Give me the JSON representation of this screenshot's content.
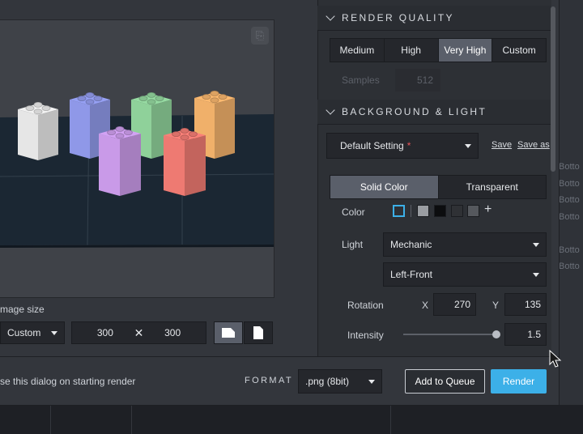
{
  "viewport": {
    "bricks": [
      {
        "name": "white",
        "color": "#e6e6e6"
      },
      {
        "name": "blue",
        "color": "#8f98e8"
      },
      {
        "name": "green",
        "color": "#8fd19a"
      },
      {
        "name": "orange",
        "color": "#f0b06a"
      },
      {
        "name": "purple",
        "color": "#c99ae8"
      },
      {
        "name": "red",
        "color": "#ee7a72"
      }
    ]
  },
  "image_size": {
    "label": "mage size",
    "preset": "Custom",
    "width": "300",
    "times": "✕",
    "height": "300"
  },
  "footer": {
    "close_text": "se this dialog on starting render",
    "format_label": "FORMAT",
    "format_value": ".png (8bit)",
    "add_to_queue": "Add to Queue",
    "render": "Render"
  },
  "render_quality": {
    "title": "RENDER QUALITY",
    "options": [
      "Medium",
      "High",
      "Very High",
      "Custom"
    ],
    "selected": "Very High",
    "samples_label": "Samples",
    "samples_value": "512"
  },
  "background_light": {
    "title": "BACKGROUND & LIGHT",
    "preset": "Default Setting",
    "preset_marker": "*",
    "save": "Save",
    "save_as": "Save as",
    "modes": [
      "Solid Color",
      "Transparent"
    ],
    "mode_selected": "Solid Color",
    "color_label": "Color",
    "swatches": [
      "#2d3035",
      "#9a9da2",
      "#0c0d0f",
      "#2f3135",
      "#55585d"
    ],
    "add_swatch": "+",
    "light_label": "Light",
    "light_value": "Mechanic",
    "light_direction": "Left-Front",
    "rotation_label": "Rotation",
    "rotation_x_label": "X",
    "rotation_x": "270",
    "rotation_y_label": "Y",
    "rotation_y": "135",
    "intensity_label": "Intensity",
    "intensity_value": "1.5"
  },
  "background_app": {
    "bottom_items": [
      "Botto",
      "Botto",
      "Botto",
      "Botto",
      "Botto",
      "Botto"
    ]
  },
  "colors": {
    "accent": "#3cb0e8",
    "required_marker": "#e8545a"
  }
}
